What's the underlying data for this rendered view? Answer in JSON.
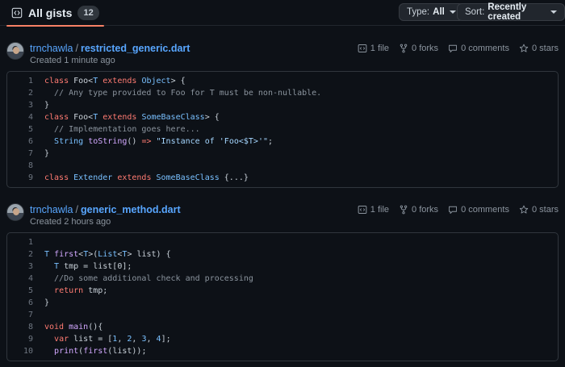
{
  "topbar": {
    "tab_label": "All gists",
    "tab_count": "12",
    "type_label": "Type:",
    "type_value": "All",
    "sort_label": "Sort:",
    "sort_value": "Recently created"
  },
  "gists": [
    {
      "owner": "trnchawla",
      "filename": "restricted_generic.dart",
      "created": "Created 1 minute ago",
      "files": "1 file",
      "forks": "0 forks",
      "comments": "0 comments",
      "stars": "0 stars",
      "lines": [
        [
          {
            "t": "class ",
            "c": "kw"
          },
          {
            "t": "Foo<",
            "c": ""
          },
          {
            "t": "T",
            "c": "ty"
          },
          {
            "t": " extends ",
            "c": "kw"
          },
          {
            "t": "Object",
            "c": "ty"
          },
          {
            "t": "> {",
            "c": ""
          }
        ],
        [
          {
            "t": "  // Any type provided to Foo for T must be non-nullable.",
            "c": "cm"
          }
        ],
        [
          {
            "t": "}",
            "c": ""
          }
        ],
        [
          {
            "t": "class ",
            "c": "kw"
          },
          {
            "t": "Foo<",
            "c": ""
          },
          {
            "t": "T",
            "c": "ty"
          },
          {
            "t": " extends ",
            "c": "kw"
          },
          {
            "t": "SomeBaseClass",
            "c": "ty"
          },
          {
            "t": "> {",
            "c": ""
          }
        ],
        [
          {
            "t": "  // Implementation goes here...",
            "c": "cm"
          }
        ],
        [
          {
            "t": "  ",
            "c": ""
          },
          {
            "t": "String",
            "c": "ty"
          },
          {
            "t": " ",
            "c": ""
          },
          {
            "t": "toString",
            "c": "fn"
          },
          {
            "t": "() ",
            "c": ""
          },
          {
            "t": "=>",
            "c": "kw"
          },
          {
            "t": " ",
            "c": ""
          },
          {
            "t": "\"Instance of 'Foo<$T>'\"",
            "c": "st"
          },
          {
            "t": ";",
            "c": ""
          }
        ],
        [
          {
            "t": "}",
            "c": ""
          }
        ],
        [
          {
            "t": "",
            "c": ""
          }
        ],
        [
          {
            "t": "class ",
            "c": "kw"
          },
          {
            "t": "Extender",
            "c": "ty"
          },
          {
            "t": " extends ",
            "c": "kw"
          },
          {
            "t": "SomeBaseClass",
            "c": "ty"
          },
          {
            "t": " {...}",
            "c": ""
          }
        ]
      ]
    },
    {
      "owner": "trnchawla",
      "filename": "generic_method.dart",
      "created": "Created 2 hours ago",
      "files": "1 file",
      "forks": "0 forks",
      "comments": "0 comments",
      "stars": "0 stars",
      "lines": [
        [
          {
            "t": "",
            "c": ""
          }
        ],
        [
          {
            "t": "T",
            "c": "ty"
          },
          {
            "t": " ",
            "c": ""
          },
          {
            "t": "first",
            "c": "fn"
          },
          {
            "t": "<",
            "c": ""
          },
          {
            "t": "T",
            "c": "ty"
          },
          {
            "t": ">(",
            "c": ""
          },
          {
            "t": "List",
            "c": "ty"
          },
          {
            "t": "<",
            "c": ""
          },
          {
            "t": "T",
            "c": "ty"
          },
          {
            "t": "> list) {",
            "c": ""
          }
        ],
        [
          {
            "t": "  ",
            "c": ""
          },
          {
            "t": "T",
            "c": "ty"
          },
          {
            "t": " tmp = list[0];",
            "c": ""
          }
        ],
        [
          {
            "t": "  //Do some additional check and processing",
            "c": "cm"
          }
        ],
        [
          {
            "t": "  ",
            "c": ""
          },
          {
            "t": "return",
            "c": "kw"
          },
          {
            "t": " tmp;",
            "c": ""
          }
        ],
        [
          {
            "t": "}",
            "c": ""
          }
        ],
        [
          {
            "t": "",
            "c": ""
          }
        ],
        [
          {
            "t": "void",
            "c": "kw"
          },
          {
            "t": " ",
            "c": ""
          },
          {
            "t": "main",
            "c": "fn"
          },
          {
            "t": "(){",
            "c": ""
          }
        ],
        [
          {
            "t": "  ",
            "c": ""
          },
          {
            "t": "var",
            "c": "kw"
          },
          {
            "t": " list = [",
            "c": ""
          },
          {
            "t": "1",
            "c": "ty"
          },
          {
            "t": ", ",
            "c": ""
          },
          {
            "t": "2",
            "c": "ty"
          },
          {
            "t": ", ",
            "c": ""
          },
          {
            "t": "3",
            "c": "ty"
          },
          {
            "t": ", ",
            "c": ""
          },
          {
            "t": "4",
            "c": "ty"
          },
          {
            "t": "];",
            "c": ""
          }
        ],
        [
          {
            "t": "  ",
            "c": ""
          },
          {
            "t": "print",
            "c": "fn"
          },
          {
            "t": "(",
            "c": ""
          },
          {
            "t": "first",
            "c": "fn"
          },
          {
            "t": "(list));",
            "c": ""
          }
        ]
      ]
    }
  ]
}
